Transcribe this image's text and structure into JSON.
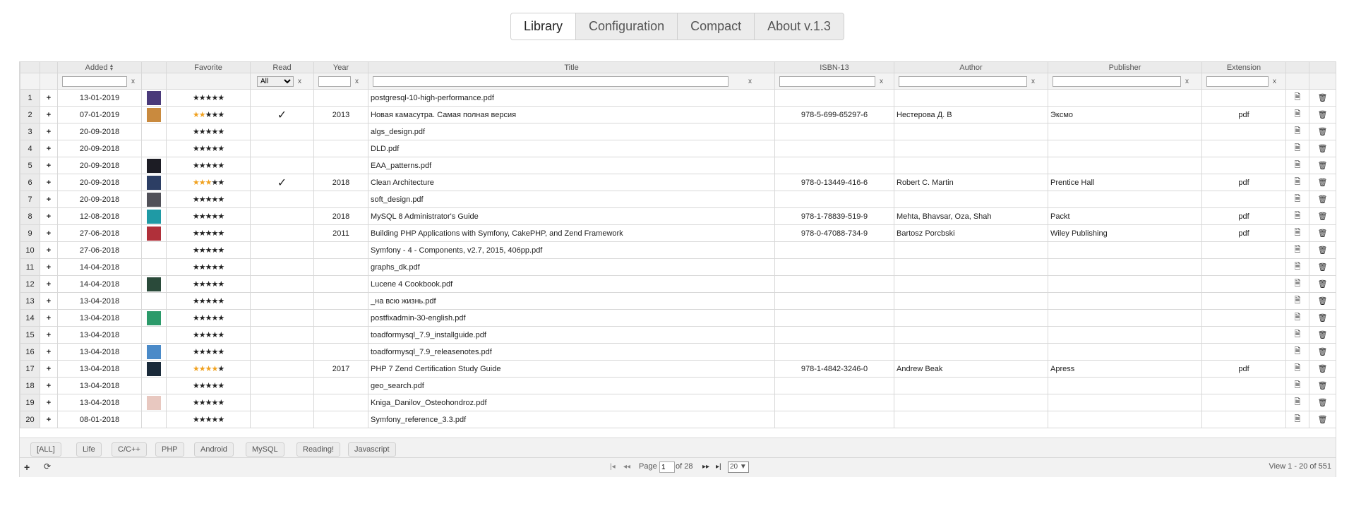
{
  "tabs": [
    "Library",
    "Configuration",
    "Compact",
    "About v.1.3"
  ],
  "columns": [
    "Added",
    "Favorite",
    "Read",
    "Year",
    "Title",
    "ISBN-13",
    "Author",
    "Publisher",
    "Extension"
  ],
  "filters": {
    "clear_label": "x",
    "read_select": "All"
  },
  "rows": [
    {
      "n": "1",
      "added": "13-01-2019",
      "thumb": "#4a3a7a",
      "stars": 0,
      "read": "",
      "year": "",
      "title": "postgresql-10-high-performance.pdf",
      "isbn": "",
      "author": "",
      "publisher": "",
      "ext": ""
    },
    {
      "n": "2",
      "added": "07-01-2019",
      "thumb": "#c98a3e",
      "stars": 2,
      "read": "✓",
      "year": "2013",
      "title": "Новая камасутра. Самая полная версия",
      "isbn": "978-5-699-65297-6",
      "author": "Нестерова Д. В",
      "publisher": "Эксмо",
      "ext": "pdf"
    },
    {
      "n": "3",
      "added": "20-09-2018",
      "thumb": "",
      "stars": 0,
      "read": "",
      "year": "",
      "title": "algs_design.pdf",
      "isbn": "",
      "author": "",
      "publisher": "",
      "ext": ""
    },
    {
      "n": "4",
      "added": "20-09-2018",
      "thumb": "",
      "stars": 0,
      "read": "",
      "year": "",
      "title": "DLD.pdf",
      "isbn": "",
      "author": "",
      "publisher": "",
      "ext": ""
    },
    {
      "n": "5",
      "added": "20-09-2018",
      "thumb": "#1c1c24",
      "stars": 0,
      "read": "",
      "year": "",
      "title": "EAA_patterns.pdf",
      "isbn": "",
      "author": "",
      "publisher": "",
      "ext": ""
    },
    {
      "n": "6",
      "added": "20-09-2018",
      "thumb": "#2c3e64",
      "stars": 3,
      "read": "✓",
      "year": "2018",
      "title": "Clean Architecture",
      "isbn": "978-0-13449-416-6",
      "author": "Robert C. Martin",
      "publisher": "Prentice Hall",
      "ext": "pdf"
    },
    {
      "n": "7",
      "added": "20-09-2018",
      "thumb": "#505058",
      "stars": 0,
      "read": "",
      "year": "",
      "title": "soft_design.pdf",
      "isbn": "",
      "author": "",
      "publisher": "",
      "ext": ""
    },
    {
      "n": "8",
      "added": "12-08-2018",
      "thumb": "#1f9aa5",
      "stars": 0,
      "read": "",
      "year": "2018",
      "title": "MySQL 8 Administrator's Guide",
      "isbn": "978-1-78839-519-9",
      "author": "Mehta, Bhavsar, Oza, Shah",
      "publisher": "Packt",
      "ext": "pdf"
    },
    {
      "n": "9",
      "added": "27-06-2018",
      "thumb": "#b0303a",
      "stars": 0,
      "read": "",
      "year": "2011",
      "title": "Building PHP Applications with Symfony, CakePHP, and Zend Framework",
      "isbn": "978-0-47088-734-9",
      "author": "Bartosz Porcbski",
      "publisher": "Wiley Publishing",
      "ext": "pdf"
    },
    {
      "n": "10",
      "added": "27-06-2018",
      "thumb": "",
      "stars": 0,
      "read": "",
      "year": "",
      "title": "Symfony - 4 - Components, v2.7, 2015, 406pp.pdf",
      "isbn": "",
      "author": "",
      "publisher": "",
      "ext": ""
    },
    {
      "n": "11",
      "added": "14-04-2018",
      "thumb": "",
      "stars": 0,
      "read": "",
      "year": "",
      "title": "graphs_dk.pdf",
      "isbn": "",
      "author": "",
      "publisher": "",
      "ext": ""
    },
    {
      "n": "12",
      "added": "14-04-2018",
      "thumb": "#2a4a3a",
      "stars": 0,
      "read": "",
      "year": "",
      "title": "Lucene 4 Cookbook.pdf",
      "isbn": "",
      "author": "",
      "publisher": "",
      "ext": ""
    },
    {
      "n": "13",
      "added": "13-04-2018",
      "thumb": "",
      "stars": 0,
      "read": "",
      "year": "",
      "title": "_на всю жизнь.pdf",
      "isbn": "",
      "author": "",
      "publisher": "",
      "ext": ""
    },
    {
      "n": "14",
      "added": "13-04-2018",
      "thumb": "#2b9a6a",
      "stars": 0,
      "read": "",
      "year": "",
      "title": "postfixadmin-30-english.pdf",
      "isbn": "",
      "author": "",
      "publisher": "",
      "ext": ""
    },
    {
      "n": "15",
      "added": "13-04-2018",
      "thumb": "",
      "stars": 0,
      "read": "",
      "year": "",
      "title": "toadformysql_7.9_installguide.pdf",
      "isbn": "",
      "author": "",
      "publisher": "",
      "ext": ""
    },
    {
      "n": "16",
      "added": "13-04-2018",
      "thumb": "#4a8ac8",
      "stars": 0,
      "read": "",
      "year": "",
      "title": "toadformysql_7.9_releasenotes.pdf",
      "isbn": "",
      "author": "",
      "publisher": "",
      "ext": ""
    },
    {
      "n": "17",
      "added": "13-04-2018",
      "thumb": "#1a2a3a",
      "stars": 4,
      "read": "",
      "year": "2017",
      "title": "PHP 7 Zend Certification Study Guide",
      "isbn": "978-1-4842-3246-0",
      "author": "Andrew Beak",
      "publisher": "Apress",
      "ext": "pdf"
    },
    {
      "n": "18",
      "added": "13-04-2018",
      "thumb": "",
      "stars": 0,
      "read": "",
      "year": "",
      "title": "geo_search.pdf",
      "isbn": "",
      "author": "",
      "publisher": "",
      "ext": ""
    },
    {
      "n": "19",
      "added": "13-04-2018",
      "thumb": "#e8c8c0",
      "stars": 0,
      "read": "",
      "year": "",
      "title": "Kniga_Danilov_Osteohondroz.pdf",
      "isbn": "",
      "author": "",
      "publisher": "",
      "ext": ""
    },
    {
      "n": "20",
      "added": "08-01-2018",
      "thumb": "",
      "stars": 0,
      "read": "",
      "year": "",
      "title": "Symfony_reference_3.3.pdf",
      "isbn": "",
      "author": "",
      "publisher": "",
      "ext": ""
    }
  ],
  "tags": [
    "[ALL]",
    "Life",
    "C/C++",
    "PHP",
    "Android",
    "MySQL",
    "Reading!",
    "Javascript"
  ],
  "pager": {
    "page_label": "Page",
    "page_value": "1",
    "of_label": "of 28",
    "page_size": "20 ▼",
    "view_text": "View 1 - 20 of 551"
  },
  "icons": {
    "plus": "+",
    "refresh": "⟳",
    "first": "|◂",
    "prev": "◂◂",
    "next": "▸▸",
    "last": "▸|",
    "star": "★",
    "doc": "🗎",
    "trash": "🗑"
  }
}
